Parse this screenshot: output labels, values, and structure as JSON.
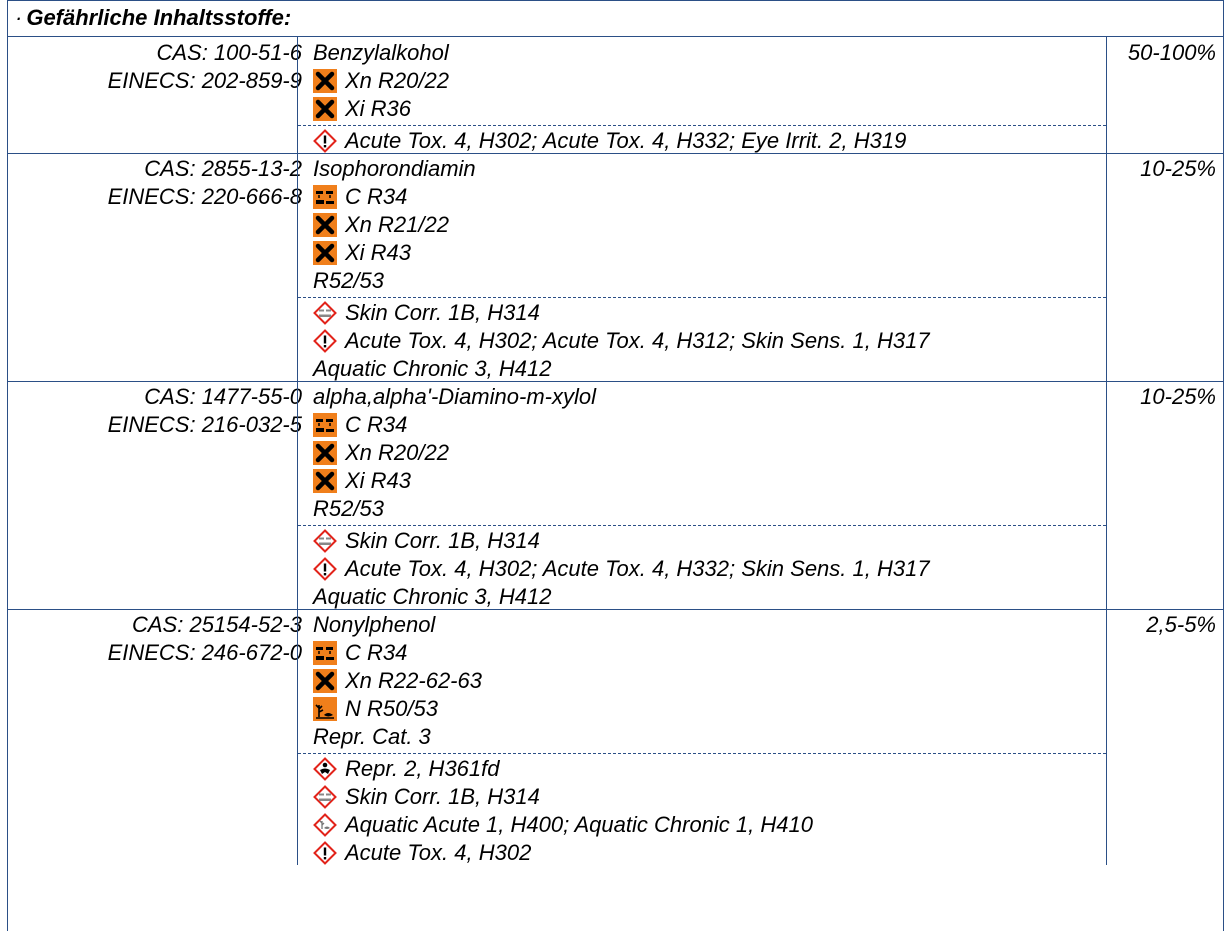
{
  "section_title": "Gefährliche Inhaltsstoffe:",
  "section_bullet": "·",
  "rows": [
    {
      "cas": "CAS: 100-51-6",
      "einecs": "EINECS: 202-859-9",
      "name": "Benzylalkohol",
      "concentration": "50-100%",
      "dsd": [
        {
          "icon": "harmful-x-icon",
          "text": "Xn R20/22"
        },
        {
          "icon": "harmful-x-icon",
          "text": "Xi R36"
        }
      ],
      "clp": [
        {
          "icon": "exclamation-diamond-icon",
          "text": "Acute Tox. 4, H302; Acute Tox. 4, H332; Eye Irrit. 2, H319"
        }
      ]
    },
    {
      "cas": "CAS: 2855-13-2",
      "einecs": "EINECS: 220-666-8",
      "name": "Isophorondiamin",
      "concentration": "10-25%",
      "dsd": [
        {
          "icon": "corrosive-icon",
          "text": "C R34"
        },
        {
          "icon": "harmful-x-icon",
          "text": "Xn R21/22"
        },
        {
          "icon": "harmful-x-icon",
          "text": "Xi R43"
        },
        {
          "icon": "",
          "text": "R52/53"
        }
      ],
      "clp": [
        {
          "icon": "corrosion-diamond-icon",
          "text": "Skin Corr. 1B, H314"
        },
        {
          "icon": "exclamation-diamond-icon",
          "text": "Acute Tox. 4, H302; Acute Tox. 4, H312; Skin Sens. 1, H317"
        },
        {
          "icon": "",
          "text": "Aquatic Chronic 3, H412"
        }
      ]
    },
    {
      "cas": "CAS: 1477-55-0",
      "einecs": "EINECS: 216-032-5",
      "name": "alpha,alpha'-Diamino-m-xylol",
      "concentration": "10-25%",
      "dsd": [
        {
          "icon": "corrosive-icon",
          "text": "C R34"
        },
        {
          "icon": "harmful-x-icon",
          "text": "Xn R20/22"
        },
        {
          "icon": "harmful-x-icon",
          "text": "Xi R43"
        },
        {
          "icon": "",
          "text": "R52/53"
        }
      ],
      "clp": [
        {
          "icon": "corrosion-diamond-icon",
          "text": "Skin Corr. 1B, H314"
        },
        {
          "icon": "exclamation-diamond-icon",
          "text": "Acute Tox. 4, H302; Acute Tox. 4, H332; Skin Sens. 1, H317"
        },
        {
          "icon": "",
          "text": "Aquatic Chronic 3, H412"
        }
      ]
    },
    {
      "cas": "CAS: 25154-52-3",
      "einecs": "EINECS: 246-672-0",
      "name": "Nonylphenol",
      "concentration": "2,5-5%",
      "dsd": [
        {
          "icon": "corrosive-icon",
          "text": "C R34"
        },
        {
          "icon": "harmful-x-icon",
          "text": "Xn R22-62-63"
        },
        {
          "icon": "environment-hazard-icon",
          "text": "N R50/53"
        },
        {
          "icon": "",
          "text": "Repr. Cat. 3"
        }
      ],
      "clp": [
        {
          "icon": "health-hazard-diamond-icon",
          "text": "Repr. 2, H361fd"
        },
        {
          "icon": "corrosion-diamond-icon",
          "text": "Skin Corr. 1B, H314"
        },
        {
          "icon": "environment-diamond-icon",
          "text": "Aquatic Acute 1, H400; Aquatic Chronic 1, H410"
        },
        {
          "icon": "exclamation-diamond-icon",
          "text": "Acute Tox. 4, H302"
        }
      ]
    }
  ],
  "colors": {
    "rule": "#2b4f86",
    "orange_pictogram": "#f07f1b",
    "ghs_red": "#e2231a"
  }
}
